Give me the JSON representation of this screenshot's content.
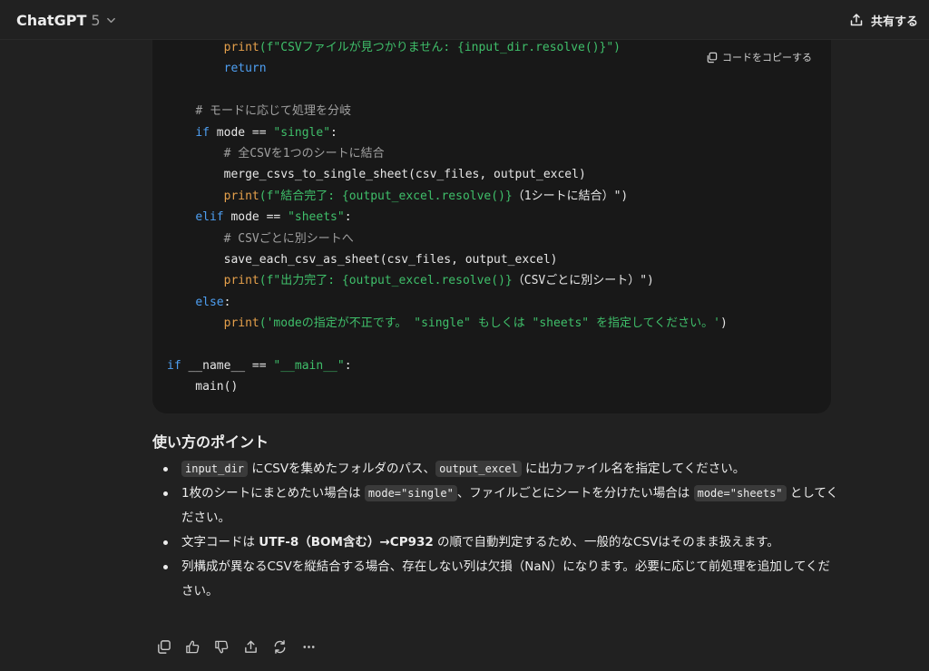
{
  "header": {
    "model_name": "ChatGPT",
    "model_version": "5",
    "share_label": "共有する"
  },
  "code_block": {
    "copy_label": "コードをコピーする",
    "lines": [
      [
        {
          "t": "        "
        },
        {
          "t": "print",
          "c": "f"
        },
        {
          "t": "(f\"CSVファイルが見つかりません: {input_dir.resolve()}\")",
          "c": "s"
        }
      ],
      [
        {
          "t": "        "
        },
        {
          "t": "return",
          "c": "k"
        }
      ],
      [
        {
          "t": ""
        }
      ],
      [
        {
          "t": "    "
        },
        {
          "t": "# モードに応じて処理を分岐",
          "c": "c"
        }
      ],
      [
        {
          "t": "    "
        },
        {
          "t": "if",
          "c": "k"
        },
        {
          "t": " mode == "
        },
        {
          "t": "\"single\"",
          "c": "s"
        },
        {
          "t": ":"
        }
      ],
      [
        {
          "t": "        "
        },
        {
          "t": "# 全CSVを1つのシートに結合",
          "c": "c"
        }
      ],
      [
        {
          "t": "        merge_csvs_to_single_sheet(csv_files, output_excel)"
        }
      ],
      [
        {
          "t": "        "
        },
        {
          "t": "print",
          "c": "f"
        },
        {
          "t": "(f\"結合完了: {output_excel.resolve()}",
          "c": "s"
        },
        {
          "t": "（1シートに結合）\")"
        }
      ],
      [
        {
          "t": "    "
        },
        {
          "t": "elif",
          "c": "k"
        },
        {
          "t": " mode == "
        },
        {
          "t": "\"sheets\"",
          "c": "s"
        },
        {
          "t": ":"
        }
      ],
      [
        {
          "t": "        "
        },
        {
          "t": "# CSVごとに別シートへ",
          "c": "c"
        }
      ],
      [
        {
          "t": "        save_each_csv_as_sheet(csv_files, output_excel)"
        }
      ],
      [
        {
          "t": "        "
        },
        {
          "t": "print",
          "c": "f"
        },
        {
          "t": "(f\"出力完了: {output_excel.resolve()}",
          "c": "s"
        },
        {
          "t": "（CSVごとに別シート）\")"
        }
      ],
      [
        {
          "t": "    "
        },
        {
          "t": "else",
          "c": "k"
        },
        {
          "t": ":"
        }
      ],
      [
        {
          "t": "        "
        },
        {
          "t": "print",
          "c": "f"
        },
        {
          "t": "('modeの指定が不正です。 \"single\" もしくは \"sheets\" を指定してください。'",
          "c": "s"
        },
        {
          "t": ")"
        }
      ],
      [
        {
          "t": ""
        }
      ],
      [
        {
          "t": "if",
          "c": "k"
        },
        {
          "t": " __name__ == "
        },
        {
          "t": "\"__main__\"",
          "c": "s"
        },
        {
          "t": ":"
        }
      ],
      [
        {
          "t": "    main()"
        }
      ]
    ]
  },
  "tips": {
    "heading": "使い方のポイント",
    "items": [
      [
        {
          "code": "input_dir"
        },
        {
          "text": " にCSVを集めたフォルダのパス、"
        },
        {
          "code": "output_excel"
        },
        {
          "text": " に出力ファイル名を指定してください。"
        }
      ],
      [
        {
          "text": "1枚のシートにまとめたい場合は "
        },
        {
          "code": "mode=\"single\""
        },
        {
          "text": "、ファイルごとにシートを分けたい場合は "
        },
        {
          "code": "mode=\"sheets\""
        },
        {
          "text": " としてください。"
        }
      ],
      [
        {
          "text": "文字コードは "
        },
        {
          "bold": "UTF-8（BOM含む）→CP932"
        },
        {
          "text": " の順で自動判定するため、一般的なCSVはそのまま扱えます。"
        }
      ],
      [
        {
          "text": "列構成が異なるCSVを縦結合する場合、存在しない列は欠損（NaN）になります。必要に応じて前処理を追加してください。"
        }
      ]
    ]
  },
  "actions": [
    {
      "name": "copy-button",
      "icon": "copy-icon"
    },
    {
      "name": "good-response-button",
      "icon": "thumbs-up-icon"
    },
    {
      "name": "bad-response-button",
      "icon": "thumbs-down-icon"
    },
    {
      "name": "share-response-button",
      "icon": "share-icon"
    },
    {
      "name": "regenerate-button",
      "icon": "refresh-icon"
    },
    {
      "name": "more-actions-button",
      "icon": "more-icon"
    }
  ]
}
